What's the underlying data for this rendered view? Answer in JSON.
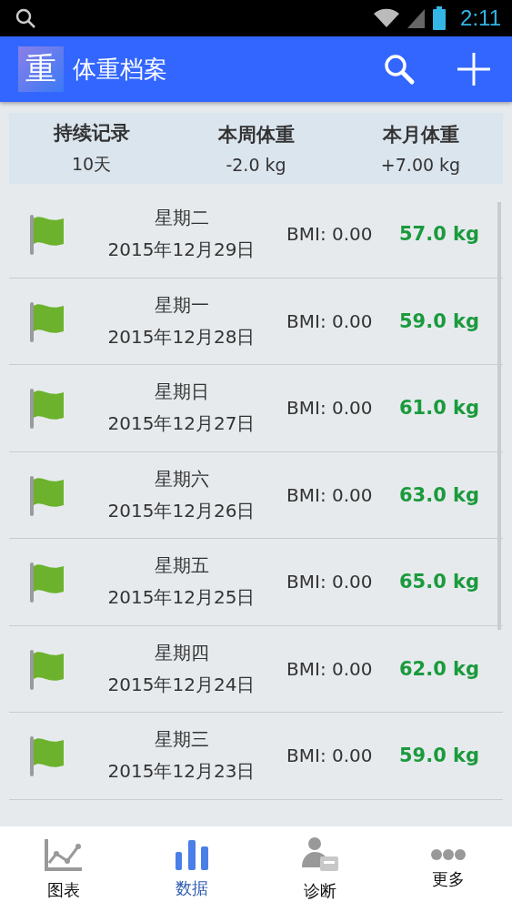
{
  "status_bar": {
    "time": "2:11"
  },
  "app_bar": {
    "logo": "重",
    "title": "体重档案"
  },
  "summary": [
    {
      "label": "持续记录",
      "value": "10天"
    },
    {
      "label": "本周体重",
      "value": "-2.0 kg"
    },
    {
      "label": "本月体重",
      "value": "+7.00 kg"
    }
  ],
  "records": [
    {
      "weekday": "星期二",
      "date": "2015年12月29日",
      "bmi": "BMI: 0.00",
      "weight": "57.0 kg"
    },
    {
      "weekday": "星期一",
      "date": "2015年12月28日",
      "bmi": "BMI: 0.00",
      "weight": "59.0 kg"
    },
    {
      "weekday": "星期日",
      "date": "2015年12月27日",
      "bmi": "BMI: 0.00",
      "weight": "61.0 kg"
    },
    {
      "weekday": "星期六",
      "date": "2015年12月26日",
      "bmi": "BMI: 0.00",
      "weight": "63.0 kg"
    },
    {
      "weekday": "星期五",
      "date": "2015年12月25日",
      "bmi": "BMI: 0.00",
      "weight": "65.0 kg"
    },
    {
      "weekday": "星期四",
      "date": "2015年12月24日",
      "bmi": "BMI: 0.00",
      "weight": "62.0 kg"
    },
    {
      "weekday": "星期三",
      "date": "2015年12月23日",
      "bmi": "BMI: 0.00",
      "weight": "59.0 kg"
    }
  ],
  "bottom_nav": [
    {
      "kind": "chart",
      "label": "图表",
      "selected": false
    },
    {
      "kind": "data",
      "label": "数据",
      "selected": true
    },
    {
      "kind": "diagnosis",
      "label": "诊断",
      "selected": false
    },
    {
      "kind": "more",
      "label": "更多",
      "selected": false
    }
  ]
}
